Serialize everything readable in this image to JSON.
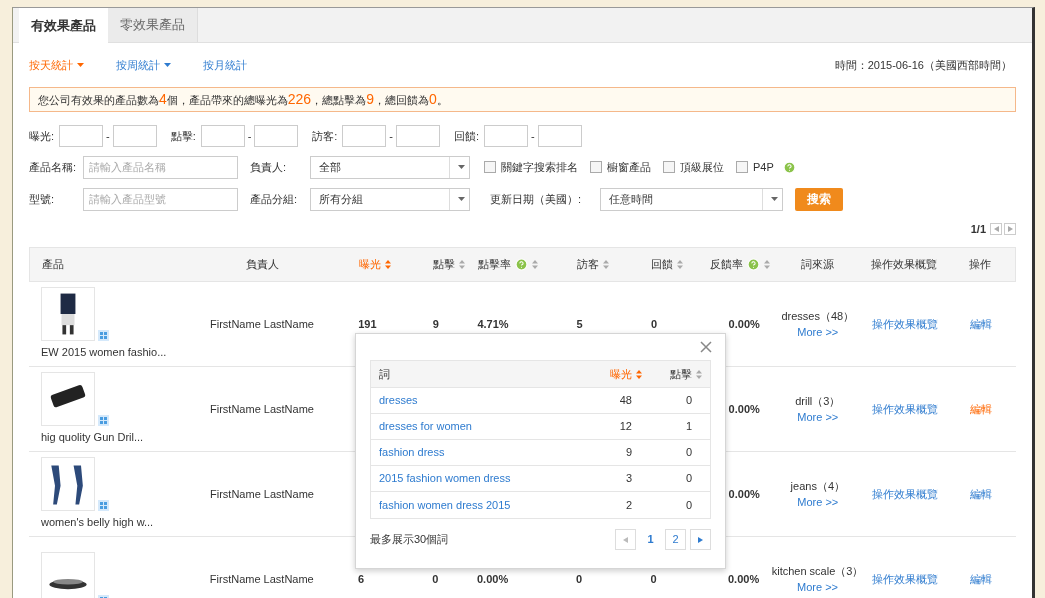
{
  "tabs": [
    {
      "label": "有效果產品",
      "selected": true
    },
    {
      "label": "零效果產品",
      "selected": false
    }
  ],
  "period_links": [
    {
      "label": "按天統計",
      "selected": true,
      "dropdown": true
    },
    {
      "label": "按周統計",
      "selected": false,
      "dropdown": true
    },
    {
      "label": "按月統計",
      "selected": false,
      "dropdown": false
    }
  ],
  "time_label": "時間：2015-06-16（美國西部時間）",
  "summary": "您公司有效果的產品數為**4**個，產品帶來的總曝光為**226**，總點擊為**9**，總回饋為**0**。",
  "ranges": [
    {
      "label": "曝光:",
      "separator": "-"
    },
    {
      "label": "點擊:",
      "separator": "-"
    },
    {
      "label": "訪客:",
      "separator": "-"
    },
    {
      "label": "回饋:",
      "separator": "-"
    }
  ],
  "filter_rows": [
    {
      "label": "產品名稱:",
      "placeholder": "請輸入產品名稱",
      "select_label": "負責人:",
      "select_value": "全部",
      "checkboxes": [
        {
          "label": "關鍵字搜索排名",
          "checked": false,
          "kind": "plain"
        },
        {
          "label": "櫥窗產品",
          "checked": false,
          "kind": "plain"
        },
        {
          "label": "頂級展位",
          "checked": false,
          "kind": "plain"
        },
        {
          "label": "P4P",
          "checked": false,
          "kind": "help"
        }
      ]
    },
    {
      "label": "型號:",
      "placeholder": "請輸入產品型號",
      "select_label": "產品分組:",
      "select_value": "所有分組",
      "date_label": "更新日期（美國）:",
      "date_value": "任意時間",
      "search_button": "搜索"
    }
  ],
  "pagination": "1/1",
  "columns": [
    {
      "label": "產品",
      "kind": "plain",
      "active": false
    },
    {
      "label": "負責人",
      "kind": "plain",
      "active": false
    },
    {
      "label": "曝光",
      "kind": "sort",
      "active": true
    },
    {
      "label": "點擊",
      "kind": "sort",
      "active": false
    },
    {
      "label": "點擊率",
      "kind": "sort_help",
      "active": false
    },
    {
      "label": "訪客",
      "kind": "sort",
      "active": false
    },
    {
      "label": "回饋",
      "kind": "sort",
      "active": false
    },
    {
      "label": "反饋率",
      "kind": "sort_help",
      "active": false
    },
    {
      "label": "詞來源",
      "kind": "plain",
      "active": false
    },
    {
      "label": "操作效果概覽",
      "kind": "plain",
      "active": false
    },
    {
      "label": "操作",
      "kind": "plain",
      "active": false
    }
  ],
  "rows": [
    {
      "product": "EW 2015 women fashio...",
      "kind": "dress",
      "owner": "FirstName LastName",
      "impressions": "191",
      "clicks": "9",
      "ctr": "4.71%",
      "visitors": "5",
      "feedback": "0",
      "feedback_rate": "0.00%",
      "source": "dresses（48）",
      "more": "More >>",
      "overview": "操作效果概覽",
      "action": "編輯",
      "hovered": false
    },
    {
      "product": "hig quolity Gun Dril...",
      "kind": "drill",
      "owner": "FirstName LastName",
      "feedback_rate": "0.00%",
      "source": "drill（3）",
      "more": "More >>",
      "overview": "操作效果概覽",
      "action": "編輯",
      "hovered": true
    },
    {
      "product": "women's belly high w...",
      "kind": "jeans",
      "owner": "FirstName LastName",
      "feedback_rate": "0.00%",
      "source": "jeans（4）",
      "more": "More >>",
      "overview": "操作效果概覽",
      "action": "編輯",
      "hovered": false
    },
    {
      "kind": "scale",
      "owner": "FirstName LastName",
      "impressions": "6",
      "clicks": "0",
      "ctr": "0.00%",
      "visitors": "0",
      "feedback": "0",
      "feedback_rate": "0.00%",
      "source": "kitchen scale（3）",
      "more": "More >>",
      "overview": "操作效果概覽",
      "action": "編輯",
      "hovered": false
    }
  ],
  "popup": {
    "columns": [
      {
        "label": "詞",
        "kind": "plain",
        "active": false
      },
      {
        "label": "曝光",
        "kind": "sort",
        "active": true
      },
      {
        "label": "點擊",
        "kind": "sort",
        "active": false
      }
    ],
    "rows": [
      {
        "word": "dresses",
        "impressions": "48",
        "clicks": "0"
      },
      {
        "word": "dresses for women",
        "impressions": "12",
        "clicks": "1"
      },
      {
        "word": "fashion dress",
        "impressions": "9",
        "clicks": "0"
      },
      {
        "word": "2015 fashion women dress",
        "impressions": "3",
        "clicks": "0"
      },
      {
        "word": "fashion women dress 2015",
        "impressions": "2",
        "clicks": "0"
      }
    ],
    "note": "最多展示30個詞",
    "pages": [
      {
        "label": "1",
        "selected": true
      },
      {
        "label": "2",
        "selected": false
      }
    ]
  }
}
